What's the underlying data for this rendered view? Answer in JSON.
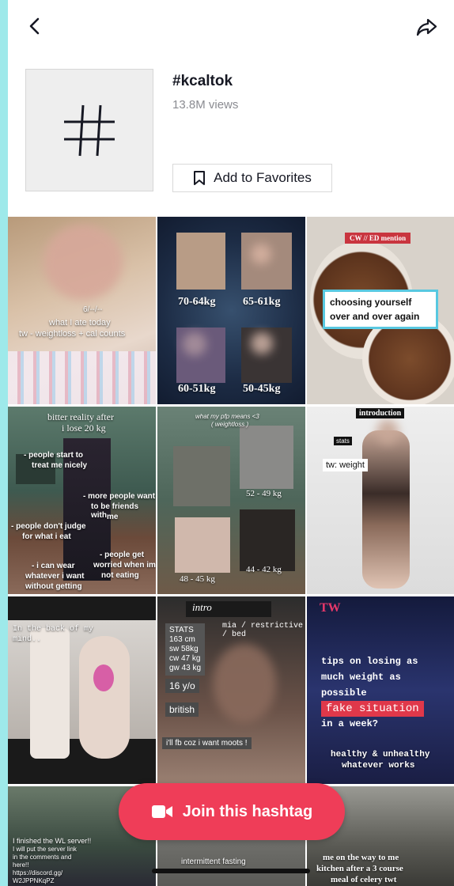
{
  "header": {
    "back_icon": "chevron-left-icon",
    "share_icon": "share-arrow-icon"
  },
  "hashtag": {
    "symbol": "#",
    "title": "#kcaltok",
    "views": "13.8M views",
    "favorite_label": "Add to Favorites"
  },
  "videos": [
    {
      "captions": [
        "6/--/--",
        "what I ate today",
        "tw - weightloss + cal counts"
      ]
    },
    {
      "captions": [
        "70-64kg",
        "65-61kg",
        "60-51kg",
        "50-45kg"
      ]
    },
    {
      "captions": [
        "CW // ED mention",
        "choosing yourself",
        "over and over again"
      ]
    },
    {
      "captions": [
        "bitter reality after",
        "i lose 20 kg",
        "- people start to",
        "treat me nicely",
        "- more people want",
        "to be friends with",
        "me",
        "- people don't judge",
        "for what i eat",
        "- people get",
        "worried when im",
        "not eating",
        "- i can wear",
        "whatever i want",
        "without getting"
      ]
    },
    {
      "captions": [
        "what my pfp means <3",
        "( weightloss )",
        "52 - 49 kg",
        "48 - 45 kg",
        "44 - 42 kg"
      ]
    },
    {
      "captions": [
        "introduction",
        "stats",
        "tw: weight"
      ]
    },
    {
      "captions": [
        "In the back of my",
        "mind.."
      ]
    },
    {
      "captions": [
        "intro",
        "mia / restrictive / bed",
        "STATS",
        "163 cm",
        "sw 58kg",
        "cw 47 kg",
        "gw 43 kg",
        "16 y/o",
        "british",
        "i'll fb coz i want moots !"
      ]
    },
    {
      "captions": [
        "TW",
        "tips on losing as",
        "much weight as",
        "possible",
        "fake situation",
        "in a week?",
        "healthy & unhealthy",
        "whatever works"
      ]
    },
    {
      "captions": [
        "I finished the WL server!!",
        "I will put the server link",
        "in the comments and",
        "here!!",
        "https://discord.gg/",
        "W2JPPNKqPZ"
      ]
    },
    {
      "captions": [
        "intermittent fasting"
      ]
    },
    {
      "captions": [
        "me on the way to me",
        "kitchen after a 3 course",
        "meal of celery twt"
      ]
    }
  ],
  "join": {
    "label": "Join this hashtag",
    "icon": "video-camera-icon"
  },
  "colors": {
    "accent": "#ef3d58",
    "background": "#9ee9ea"
  }
}
